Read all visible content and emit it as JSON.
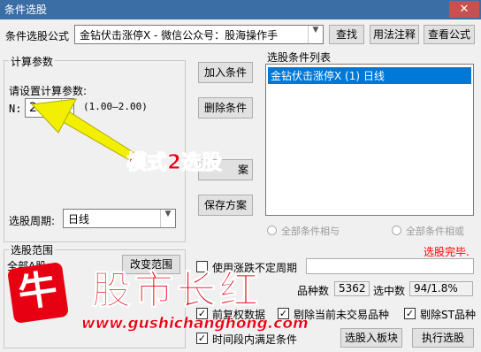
{
  "window": {
    "title": "条件选股",
    "close_glyph": "✕"
  },
  "formula": {
    "label": "条件选股公式",
    "value": "金钻伏击涨停X  -  微信公众号：股海操作手",
    "find_button": "查找",
    "usage_button": "用法注释",
    "view_button": "查看公式"
  },
  "params": {
    "title": "计算参数",
    "prompt": "请设置计算参数:",
    "n_label": "N:",
    "n_value": "2",
    "n_range": "(1.00—2.00)"
  },
  "period": {
    "label": "选股周期:",
    "value": "日线"
  },
  "actions": {
    "add": "加入条件",
    "delete": "删除条件",
    "read_partial": "案",
    "save": "保存方案"
  },
  "conditions": {
    "title": "选股条件列表",
    "items": [
      "金钻伏击涨停X (1) 日线"
    ],
    "and_label": "全部条件相与",
    "or_label": "全部条件相或",
    "status": "选股完毕."
  },
  "scope": {
    "title": "选股范围",
    "partial_text": "全部A股",
    "change_button": "改变范围"
  },
  "options": {
    "indeterminate_label": "使用涨跌不定周期",
    "count_label": "品种数",
    "count_value": "5362",
    "selected_label": "选中数",
    "selected_value": "94/1.8%",
    "fq_label": "前复权数据",
    "exclude_untraded_label": "剔除当前未交易品种",
    "exclude_st_label": "剔除ST品种",
    "period_satisfy_label": "时间段内满足条件",
    "to_block_button": "选股入板块",
    "run_button": "执行选股",
    "check_glyph": "✓"
  },
  "annotation": {
    "text": "模式2选股"
  },
  "watermark": {
    "brand": "股市长红",
    "url": "www.gushichanghong.com",
    "logo_char": "牛"
  },
  "colors": {
    "title_bg": "#3a6ea5",
    "accent": "#0078d7",
    "annotation_yellow": "#f3ef00",
    "annotation_text": "#e60012",
    "status_red": "#ff0000"
  }
}
